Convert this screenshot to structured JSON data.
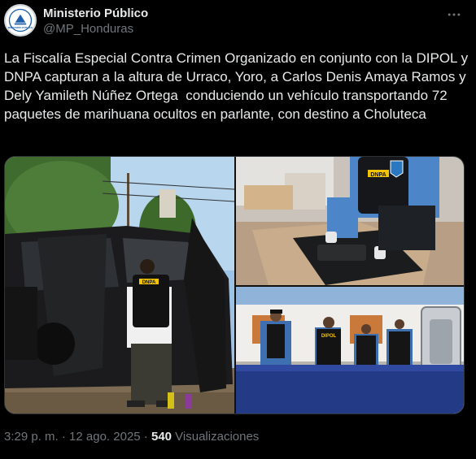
{
  "author": {
    "display_name": "Ministerio Público",
    "handle": "@MP_Honduras",
    "avatar_text": "MINISTERIO PÚBLICO"
  },
  "menu_icon": "more-horizontal-icon",
  "tweet_text": "La Fiscalía Especial Contra Crimen Organizado en conjunto con la DIPOL y DNPA capturan a la altura de Urraco, Yoro, a Carlos Denis Amaya Ramos y Dely Yamileth Núñez Ortega  conduciendo un vehículo transportando 72 paquetes de marihuana ocultos en parlante, con destino a Choluteca",
  "photos": {
    "p1": {
      "vest_label": "DNPA"
    },
    "p2": {
      "vest_label": "DNPA"
    },
    "p3": {
      "vest_labels": [
        "DIPOL"
      ]
    }
  },
  "meta": {
    "time": "3:29 p. m.",
    "separator1": " · ",
    "date": "12 ago. 2025",
    "separator2": " · ",
    "views_count": "540",
    "views_label": " Visualizaciones"
  },
  "colors": {
    "background": "#000000",
    "text_primary": "#e7e9ea",
    "text_secondary": "#71767b",
    "border": "#2f3336"
  }
}
